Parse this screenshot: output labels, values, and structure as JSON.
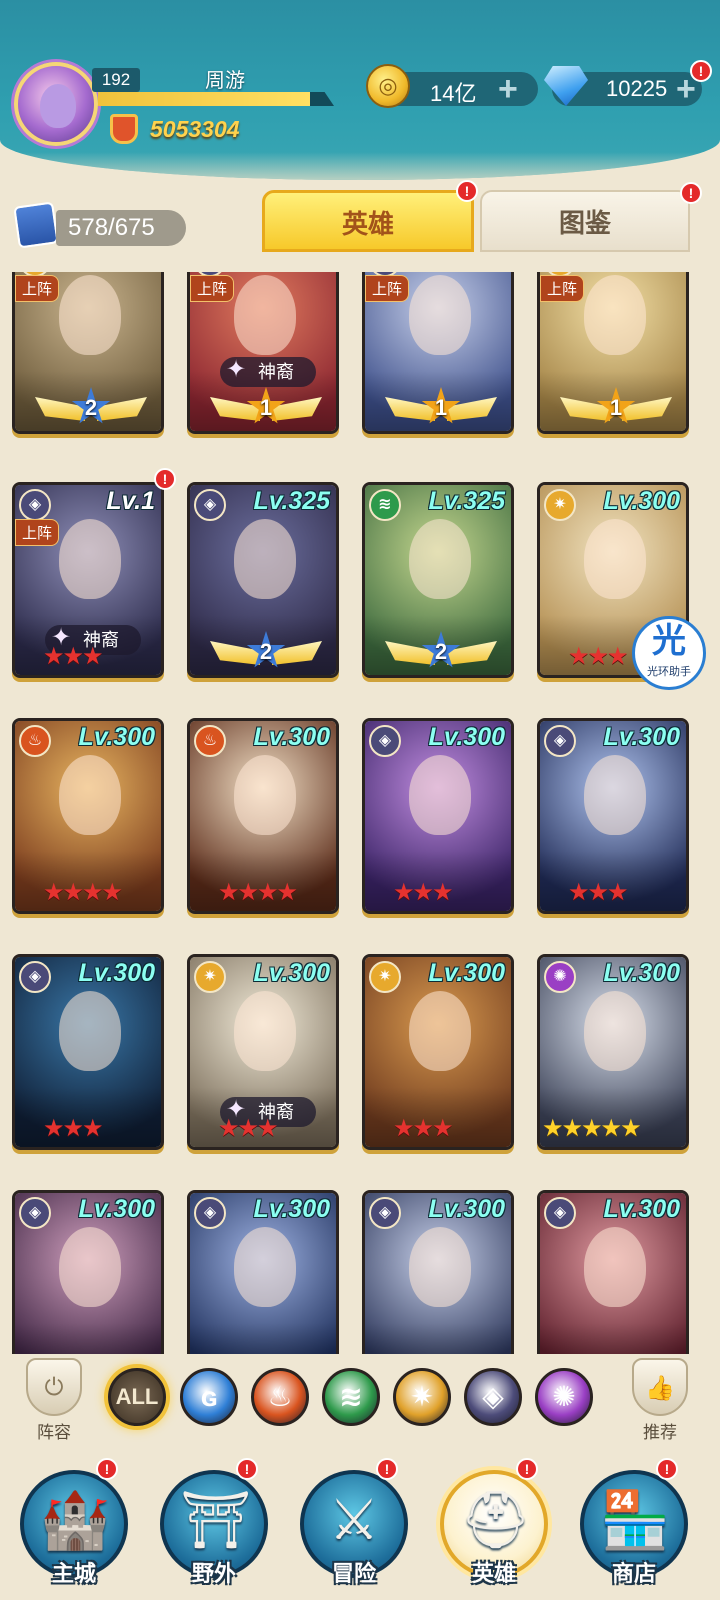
{
  "header": {
    "player_level": "192",
    "player_name": "周游",
    "exp_fraction": 0.9,
    "combat_power": "5053304",
    "gold": "14亿",
    "gems": "10225",
    "plus_glyph": "+",
    "alert_glyph": "!"
  },
  "tabs": {
    "card_count": "578/675",
    "heroes_label": "英雄",
    "codex_label": "图鉴"
  },
  "labels": {
    "deploy": "上阵",
    "divine": "神裔"
  },
  "heroes": [
    {
      "element": "light",
      "level": "",
      "deployed": true,
      "divine": false,
      "stars": "",
      "star_color": "red",
      "wing_rank": "2",
      "wing_type": "blue",
      "bg": [
        "#6d5b3b",
        "#c9b48e"
      ]
    },
    {
      "element": "dark",
      "level": "",
      "deployed": true,
      "divine": true,
      "stars": "",
      "star_color": "red",
      "wing_rank": "1",
      "wing_type": "gold",
      "bg": [
        "#8a2530",
        "#e07a5e"
      ]
    },
    {
      "element": "dark",
      "level": "",
      "deployed": true,
      "divine": false,
      "stars": "",
      "star_color": "red",
      "wing_rank": "1",
      "wing_type": "gold",
      "bg": [
        "#3d4f8a",
        "#c7d0ea"
      ]
    },
    {
      "element": "light",
      "level": "",
      "deployed": true,
      "divine": false,
      "stars": "",
      "star_color": "red",
      "wing_rank": "1",
      "wing_type": "gold",
      "bg": [
        "#a38346",
        "#f2dfa6"
      ]
    },
    {
      "element": "dark",
      "level": "Lv.1",
      "deployed": true,
      "divine": true,
      "stars": "★★★",
      "star_color": "red",
      "wing_rank": "",
      "wing_type": "",
      "bg": [
        "#2b2a4a",
        "#8f8fb8"
      ],
      "alert": true
    },
    {
      "element": "dark",
      "level": "Lv.325",
      "deployed": false,
      "divine": false,
      "stars": "",
      "star_color": "red",
      "wing_rank": "2",
      "wing_type": "blue",
      "bg": [
        "#2e2a48",
        "#6c6f9e"
      ]
    },
    {
      "element": "wind",
      "level": "Lv.325",
      "deployed": false,
      "divine": false,
      "stars": "",
      "star_color": "red",
      "wing_rank": "2",
      "wing_type": "blue",
      "bg": [
        "#3d6a3e",
        "#c5d78f"
      ]
    },
    {
      "element": "light",
      "level": "Lv.300",
      "deployed": false,
      "divine": false,
      "stars": "★★★",
      "star_color": "red",
      "wing_rank": "",
      "wing_type": "",
      "bg": [
        "#b38e51",
        "#f1e3c0"
      ]
    },
    {
      "element": "fire",
      "level": "Lv.300",
      "deployed": false,
      "divine": false,
      "stars": "★★★★",
      "star_color": "red",
      "wing_rank": "",
      "wing_type": "",
      "bg": [
        "#7a3b1d",
        "#e8b561"
      ]
    },
    {
      "element": "fire",
      "level": "Lv.300",
      "deployed": false,
      "divine": false,
      "stars": "★★★★",
      "star_color": "red",
      "wing_rank": "",
      "wing_type": "",
      "bg": [
        "#5a2a18",
        "#f2e0c6"
      ]
    },
    {
      "element": "dark",
      "level": "Lv.300",
      "deployed": false,
      "divine": false,
      "stars": "★★★",
      "star_color": "red",
      "wing_rank": "",
      "wing_type": "",
      "bg": [
        "#3a2366",
        "#c18de0"
      ]
    },
    {
      "element": "dark",
      "level": "Lv.300",
      "deployed": false,
      "divine": false,
      "stars": "★★★",
      "star_color": "red",
      "wing_rank": "",
      "wing_type": "",
      "bg": [
        "#1f2a55",
        "#b0c4ef"
      ]
    },
    {
      "element": "dark",
      "level": "Lv.300",
      "deployed": false,
      "divine": false,
      "stars": "★★★",
      "star_color": "red",
      "wing_rank": "",
      "wing_type": "",
      "bg": [
        "#0f1e35",
        "#3a78a8"
      ]
    },
    {
      "element": "light",
      "level": "Lv.300",
      "deployed": false,
      "divine": true,
      "stars": "★★★",
      "star_color": "red",
      "wing_rank": "",
      "wing_type": "",
      "bg": [
        "#7c6f5c",
        "#f1ead8"
      ]
    },
    {
      "element": "light",
      "level": "Lv.300",
      "deployed": false,
      "divine": false,
      "stars": "★★★",
      "star_color": "red",
      "wing_rank": "",
      "wing_type": "",
      "bg": [
        "#6e3a1e",
        "#d99a4f"
      ]
    },
    {
      "element": "void",
      "level": "Lv.300",
      "deployed": false,
      "divine": false,
      "stars": "★★★★★",
      "star_color": "gold",
      "wing_rank": "",
      "wing_type": "",
      "bg": [
        "#3b4156",
        "#d9e0ec"
      ]
    },
    {
      "element": "dark",
      "level": "Lv.300",
      "deployed": false,
      "divine": false,
      "stars": "",
      "star_color": "red",
      "wing_rank": "",
      "wing_type": "",
      "bg": [
        "#3c2341",
        "#cf9fbd"
      ]
    },
    {
      "element": "dark",
      "level": "Lv.300",
      "deployed": false,
      "divine": false,
      "stars": "",
      "star_color": "red",
      "wing_rank": "",
      "wing_type": "",
      "bg": [
        "#1d2e5a",
        "#9fb3e3"
      ]
    },
    {
      "element": "dark",
      "level": "Lv.300",
      "deployed": false,
      "divine": false,
      "stars": "",
      "star_color": "red",
      "wing_rank": "",
      "wing_type": "",
      "bg": [
        "#2a3458",
        "#c8d1ea"
      ]
    },
    {
      "element": "dark",
      "level": "Lv.300",
      "deployed": false,
      "divine": false,
      "stars": "",
      "star_color": "red",
      "wing_rank": "",
      "wing_type": "",
      "bg": [
        "#5b1d2a",
        "#e09aa0"
      ]
    }
  ],
  "halo_helper": {
    "glyph": "光",
    "caption": "光环助手"
  },
  "filter": {
    "lineup_label": "阵容",
    "recommend_label": "推荐",
    "all_label": "ALL",
    "elements": [
      {
        "name": "water",
        "glyph": "ɢ",
        "color": "#2f7fd6"
      },
      {
        "name": "fire",
        "glyph": "♨",
        "color": "#d9541f"
      },
      {
        "name": "wind",
        "glyph": "≋",
        "color": "#2e9a4b"
      },
      {
        "name": "light",
        "glyph": "✷",
        "color": "#e0a12a"
      },
      {
        "name": "dark",
        "glyph": "◈",
        "color": "#4d4c7a"
      },
      {
        "name": "void",
        "glyph": "✺",
        "color": "#9a3fc4"
      }
    ]
  },
  "nav": [
    {
      "label": "主城",
      "icon": "castle-icon",
      "glyph": "🏰",
      "active": false
    },
    {
      "label": "野外",
      "icon": "portal-icon",
      "glyph": "⛩",
      "active": false
    },
    {
      "label": "冒险",
      "icon": "sword-icon",
      "glyph": "⚔",
      "active": false
    },
    {
      "label": "英雄",
      "icon": "helmet-icon",
      "glyph": "⛑",
      "active": true
    },
    {
      "label": "商店",
      "icon": "shop-icon",
      "glyph": "🏪",
      "active": false
    }
  ],
  "element_colors": {
    "light": "#e7a92d",
    "dark": "#4a4a78",
    "fire": "#d9541f",
    "wind": "#2e9a4b",
    "water": "#2f7fd6",
    "void": "#9a3fc4"
  },
  "element_glyphs": {
    "light": "✷",
    "dark": "◈",
    "fire": "♨",
    "wind": "≋",
    "water": "ɢ",
    "void": "✺"
  }
}
